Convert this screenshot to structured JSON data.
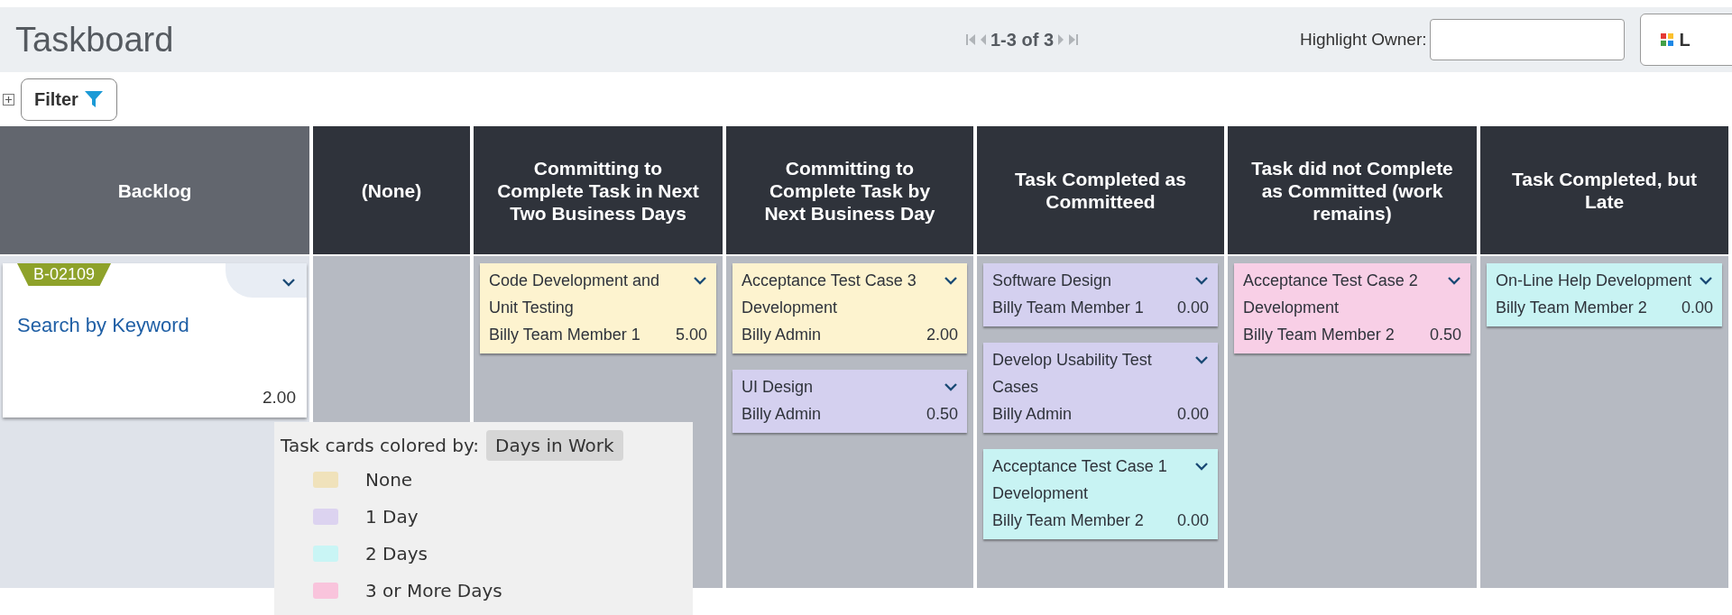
{
  "header": {
    "title": "Taskboard",
    "pager": "1-3 of 3",
    "highlight_owner": {
      "label": "Highlight Owner:"
    },
    "layout_button": {
      "label": "L"
    }
  },
  "filter": {
    "label": "Filter"
  },
  "columns": [
    {
      "title": "Backlog",
      "kind": "backlog",
      "cards": [
        {
          "id": "B-02109",
          "title": "Search by Keyword",
          "estimate": "2.00"
        }
      ]
    },
    {
      "title": "(None)",
      "kind": "state"
    },
    {
      "title": "Committing to Complete Task in Next Two Business Days",
      "kind": "state",
      "cards": [
        {
          "title": "Code Development and Unit Testing",
          "owner": "Billy Team Member 1",
          "estimate": "5.00",
          "color": "#fdf3cf"
        }
      ]
    },
    {
      "title": "Committing to Complete Task by Next Business Day",
      "kind": "state",
      "cards": [
        {
          "title": "Acceptance Test Case 3 Development",
          "owner": "Billy Admin",
          "estimate": "2.00",
          "color": "#fdf3cf"
        },
        {
          "title": "UI Design",
          "owner": "Billy Admin",
          "estimate": "0.50",
          "color": "#d4d0ef"
        }
      ]
    },
    {
      "title": "Task Completed as Committeed",
      "kind": "state",
      "cards": [
        {
          "title": "Software Design",
          "owner": "Billy Team Member 1",
          "estimate": "0.00",
          "color": "#d4d0ef"
        },
        {
          "title": "Develop Usability Test Cases",
          "owner": "Billy Admin",
          "estimate": "0.00",
          "color": "#d4d0ef"
        },
        {
          "title": "Acceptance Test Case 1 Development",
          "owner": "Billy Team Member 2",
          "estimate": "0.00",
          "color": "#c8f3f3"
        }
      ]
    },
    {
      "title": "Task did not Complete as Committed (work remains)",
      "kind": "state",
      "cards": [
        {
          "title": "Acceptance Test Case 2 Development",
          "owner": "Billy Team Member 2",
          "estimate": "0.50",
          "color": "#f8cfe6"
        }
      ]
    },
    {
      "title": "Task Completed, but Late",
      "kind": "state",
      "cards": [
        {
          "title": "On-Line Help Development",
          "owner": "Billy Team Member 2",
          "estimate": "0.00",
          "color": "#c8f3f3"
        }
      ]
    }
  ],
  "legend": {
    "label": "Task cards colored by:",
    "value": "Days in Work",
    "items": [
      {
        "label": "None",
        "color": "#f0e2bb"
      },
      {
        "label": "1 Day",
        "color": "#dcd3f0"
      },
      {
        "label": "2 Days",
        "color": "#c9f5f5"
      },
      {
        "label": "3 or More Days",
        "color": "#f9c4dc"
      }
    ]
  }
}
